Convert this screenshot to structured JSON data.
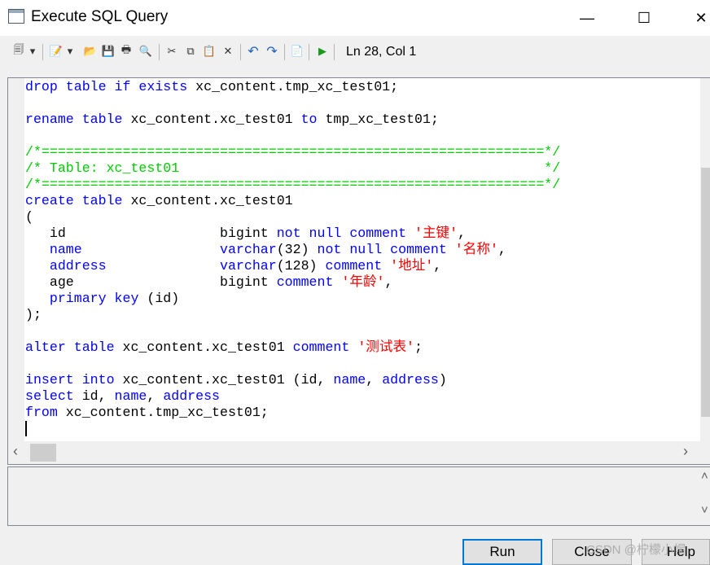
{
  "window": {
    "title": "Execute SQL Query",
    "minimize": "—",
    "maximize": "☐",
    "close": "✕"
  },
  "toolbar": {
    "icons": [
      {
        "name": "properties-icon",
        "glyph": "🗐"
      },
      {
        "name": "dropdown-arrow-icon",
        "glyph": "▾"
      },
      {
        "name": "edit-icon",
        "glyph": "📝"
      },
      {
        "name": "dropdown-arrow-icon",
        "glyph": "▾"
      },
      {
        "name": "open-folder-icon",
        "glyph": "📂"
      },
      {
        "name": "save-icon",
        "glyph": "💾"
      },
      {
        "name": "print-icon",
        "glyph": "🖶"
      },
      {
        "name": "find-icon",
        "glyph": "🔍"
      },
      {
        "name": "cut-icon",
        "glyph": "✂"
      },
      {
        "name": "copy-icon",
        "glyph": "⧉"
      },
      {
        "name": "paste-icon",
        "glyph": "📋"
      },
      {
        "name": "delete-icon",
        "glyph": "✕"
      },
      {
        "name": "undo-icon",
        "glyph": "↶"
      },
      {
        "name": "redo-icon",
        "glyph": "↷"
      },
      {
        "name": "edit-with-icon",
        "glyph": "📄"
      },
      {
        "name": "run-icon",
        "glyph": "▶"
      }
    ],
    "cursor_position": "Ln 28, Col 1"
  },
  "editor": {
    "lines": [
      [
        [
          "k",
          "drop table if exists"
        ],
        [
          "n",
          " xc_content.tmp_xc_test01;"
        ]
      ],
      [],
      [
        [
          "k",
          "rename table"
        ],
        [
          "n",
          " xc_content.xc_test01 "
        ],
        [
          "k",
          "to"
        ],
        [
          "n",
          " tmp_xc_test01;"
        ]
      ],
      [],
      [
        [
          "c",
          "/*==============================================================*/"
        ]
      ],
      [
        [
          "c",
          "/* Table: xc_test01                                             */"
        ]
      ],
      [
        [
          "c",
          "/*==============================================================*/"
        ]
      ],
      [
        [
          "k",
          "create table"
        ],
        [
          "n",
          " xc_content.xc_test01"
        ]
      ],
      [
        [
          "n",
          "("
        ]
      ],
      [
        [
          "n",
          "   id                   bigint "
        ],
        [
          "k",
          "not null comment"
        ],
        [
          "n",
          " "
        ],
        [
          "s",
          "'主键'"
        ],
        [
          "n",
          ","
        ]
      ],
      [
        [
          "k",
          "   name                 varchar"
        ],
        [
          "n",
          "(32) "
        ],
        [
          "k",
          "not null comment"
        ],
        [
          "n",
          " "
        ],
        [
          "s",
          "'名称'"
        ],
        [
          "n",
          ","
        ]
      ],
      [
        [
          "k",
          "   address              varchar"
        ],
        [
          "n",
          "(128) "
        ],
        [
          "k",
          "comment"
        ],
        [
          "n",
          " "
        ],
        [
          "s",
          "'地址'"
        ],
        [
          "n",
          ","
        ]
      ],
      [
        [
          "n",
          "   age                  bigint "
        ],
        [
          "k",
          "comment"
        ],
        [
          "n",
          " "
        ],
        [
          "s",
          "'年龄'"
        ],
        [
          "n",
          ","
        ]
      ],
      [
        [
          "k",
          "   primary key"
        ],
        [
          "n",
          " (id)"
        ]
      ],
      [
        [
          "n",
          ");"
        ]
      ],
      [],
      [
        [
          "k",
          "alter table"
        ],
        [
          "n",
          " xc_content.xc_test01 "
        ],
        [
          "k",
          "comment"
        ],
        [
          "n",
          " "
        ],
        [
          "s",
          "'测试表'"
        ],
        [
          "n",
          ";"
        ]
      ],
      [],
      [
        [
          "k",
          "insert into"
        ],
        [
          "n",
          " xc_content.xc_test01 (id, "
        ],
        [
          "k",
          "name"
        ],
        [
          "n",
          ", "
        ],
        [
          "k",
          "address"
        ],
        [
          "n",
          ")"
        ]
      ],
      [
        [
          "k",
          "select"
        ],
        [
          "n",
          " id, "
        ],
        [
          "k",
          "name"
        ],
        [
          "n",
          ", "
        ],
        [
          "k",
          "address"
        ]
      ],
      [
        [
          "k",
          "from"
        ],
        [
          "n",
          " xc_content.tmp_xc_test01;"
        ]
      ]
    ]
  },
  "scroll": {
    "left": "‹",
    "right": "›",
    "up": "˄",
    "down": "˅"
  },
  "buttons": {
    "run": "Run",
    "close": "Close",
    "help": "Help"
  },
  "watermark": "CSDN @柠檬小帽"
}
